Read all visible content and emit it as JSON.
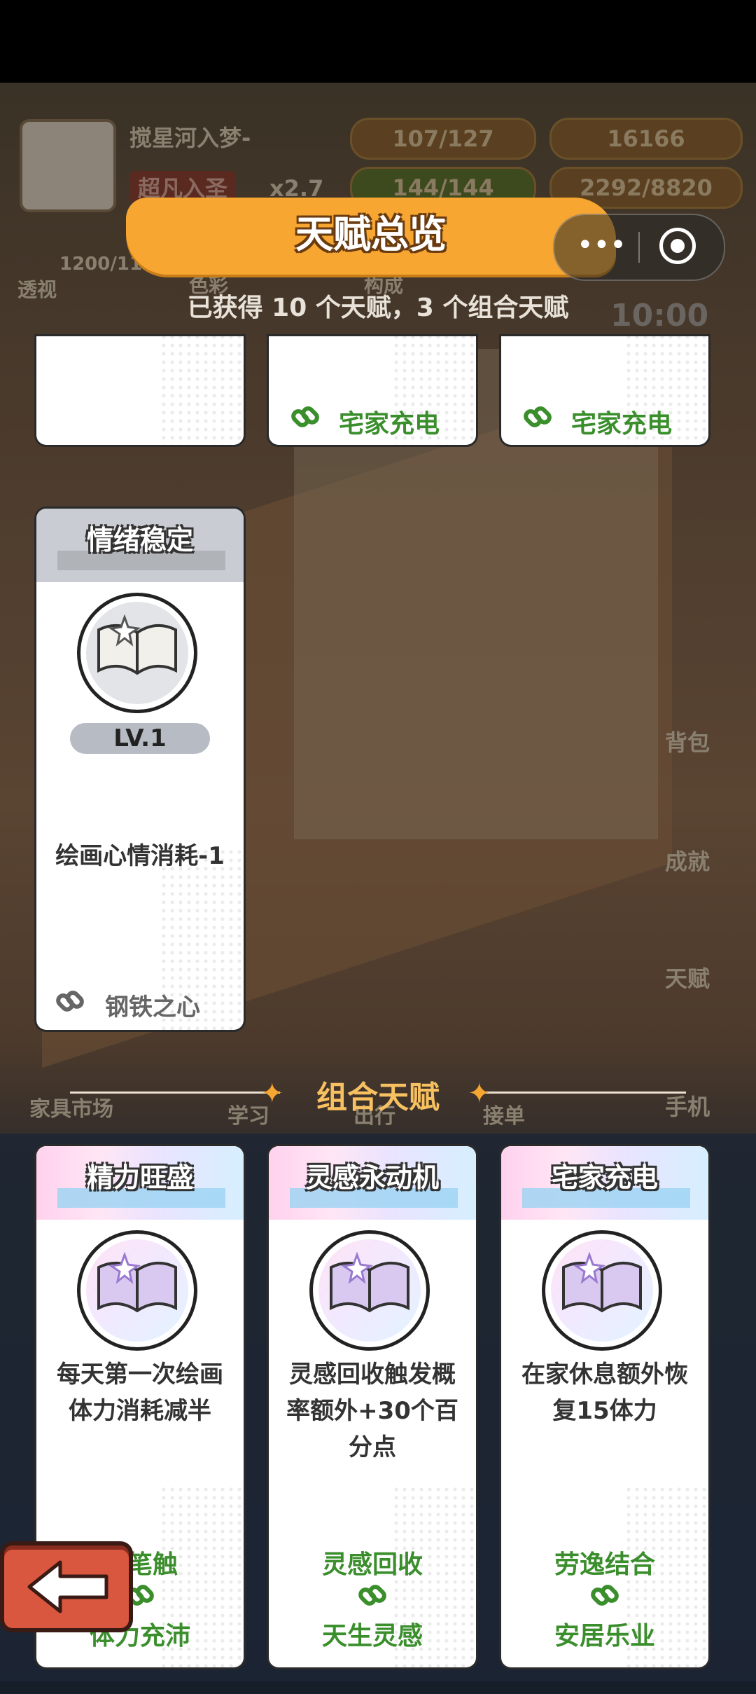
{
  "hud": {
    "player_name": "搅星河入梦-",
    "rank": "超凡入圣",
    "multiplier": "x2.7",
    "energy": "107/127",
    "coins": "16166",
    "health": "144/144",
    "exp": "2292/8820",
    "skill_value": "1200/1100",
    "skill_label": "透视",
    "stat1": "色彩",
    "stat2": "构成",
    "timer": "10:00"
  },
  "side_menu": [
    "背包",
    "成就",
    "天赋",
    "手机"
  ],
  "bottom_menu": [
    "家具市场",
    "学习",
    "出行",
    "接单"
  ],
  "title": "天赋总览",
  "subtitle": "已获得 10 个天赋，3 个组合天赋",
  "top_cards": [
    {
      "link": ""
    },
    {
      "link": "宅家充电"
    },
    {
      "link": "宅家充电"
    }
  ],
  "talent_card": {
    "name": "情绪稳定",
    "level": "LV.1",
    "description": "绘画心情消耗-1",
    "link": "钢铁之心"
  },
  "combo_section_title": "组合天赋",
  "combo_cards": [
    {
      "name": "精力旺盛",
      "desc_line1": "每天第一次绘画",
      "desc_line2": "体力消耗减半",
      "desc_line3": "",
      "req1": "妙笔触",
      "req2": "体力充沛"
    },
    {
      "name": "灵感永动机",
      "desc_line1": "灵感回收触发概",
      "desc_line2": "率额外+30个百",
      "desc_line3": "分点",
      "req1": "灵感回收",
      "req2": "天生灵感"
    },
    {
      "name": "宅家充电",
      "desc_line1": "在家休息额外恢",
      "desc_line2": "复15体力",
      "desc_line3": "",
      "req1": "劳逸结合",
      "req2": "安居乐业"
    }
  ],
  "colors": {
    "banner": "#f7a731",
    "link_green": "#3a8e2c",
    "back_button": "#d9573f"
  }
}
